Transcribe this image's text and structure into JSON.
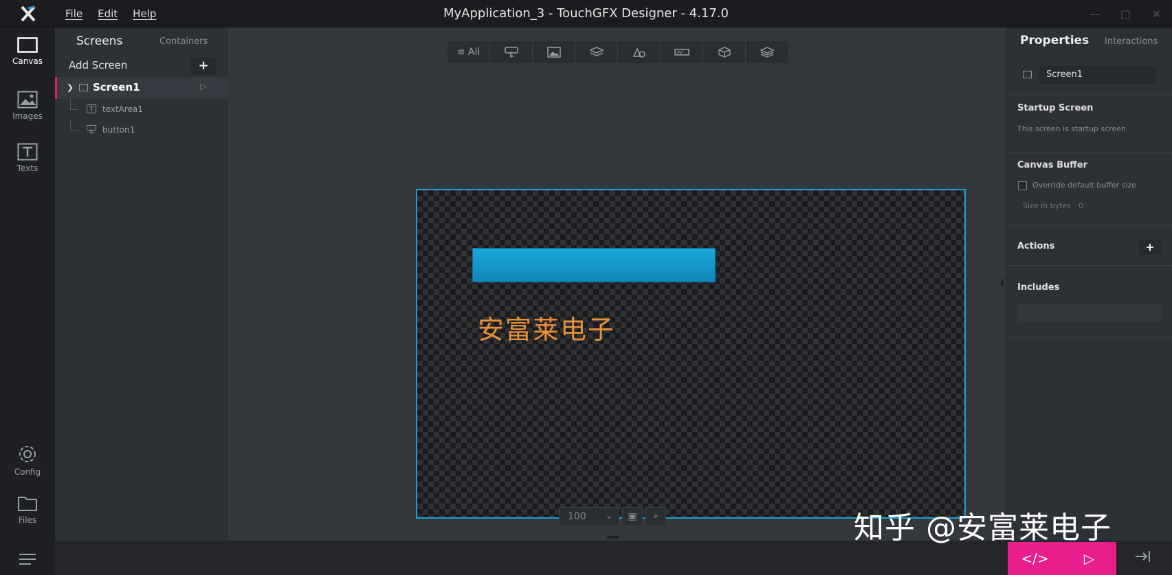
{
  "app": {
    "window_title": "MyApplication_3 - TouchGFX Designer - 4.17.0",
    "menu": [
      "File",
      "Edit",
      "Help"
    ]
  },
  "rail": {
    "canvas": "Canvas",
    "images": "Images",
    "texts": "Texts",
    "config": "Config",
    "files": "Files"
  },
  "screens_panel": {
    "tab_screens": "Screens",
    "tab_containers": "Containers",
    "add_screen": "Add Screen",
    "add_plus": "+",
    "screen": "Screen1",
    "children": [
      {
        "name": "textArea1",
        "icon": "text-area-icon"
      },
      {
        "name": "button1",
        "icon": "button-widget-icon"
      }
    ]
  },
  "toolbar": {
    "all": "All",
    "filters": [
      "button-filter-icon",
      "image-filter-icon",
      "container-filter-icon",
      "shape-filter-icon",
      "progress-filter-icon",
      "3d-filter-icon",
      "layers-filter-icon"
    ]
  },
  "stage": {
    "text": "安富莱电子",
    "text_color": "#e8913a",
    "button_color": "#1aa8dc",
    "zoom": "100"
  },
  "properties": {
    "tab_properties": "Properties",
    "tab_interactions": "Interactions",
    "name_value": "Screen1",
    "startup_title": "Startup Screen",
    "startup_note": "This screen is startup screen",
    "canvas_buffer_title": "Canvas Buffer",
    "override_label": "Override default buffer size",
    "size_label": "Size in bytes",
    "size_value": "0",
    "actions_title": "Actions",
    "actions_plus": "+",
    "includes_title": "Includes"
  },
  "watermark": "知乎 @安富莱电子",
  "accent": "#e91e8c"
}
